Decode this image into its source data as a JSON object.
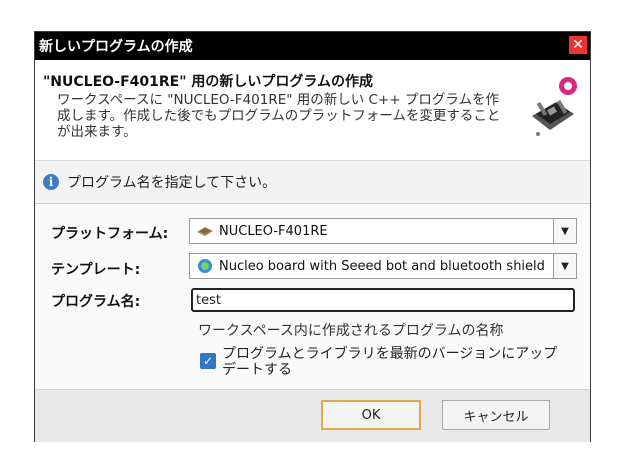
{
  "dialog": {
    "title": "新しいプログラムの作成",
    "close_glyph": "✕"
  },
  "header": {
    "title": "\"NUCLEO-F401RE\" 用の新しいプログラムの作成",
    "description": "ワークスペースに \"NUCLEO-F401RE\" 用の新しい C++ プログラムを作成します。作成した後でもプログラムのプラットフォームを変更することが出来ます。",
    "image_icon": "board-icon"
  },
  "info": {
    "icon": "info-icon",
    "icon_glyph": "i",
    "message": "プログラム名を指定して下さい。"
  },
  "form": {
    "platform_label": "プラットフォーム:",
    "platform_value": "NUCLEO-F401RE",
    "template_label": "テンプレート:",
    "template_value": "Nucleo board with Seeed bot and bluetooth shield",
    "program_name_label": "プログラム名:",
    "program_name_value": "test",
    "program_name_hint": "ワークスペース内に作成されるプログラムの名称",
    "update_checkbox_label": "プログラムとライブラリを最新のバージョンにアップデートする",
    "update_checked": true,
    "check_glyph": "✓",
    "dropdown_glyph": "▼"
  },
  "buttons": {
    "ok_label": "OK",
    "cancel_label": "キャンセル"
  }
}
